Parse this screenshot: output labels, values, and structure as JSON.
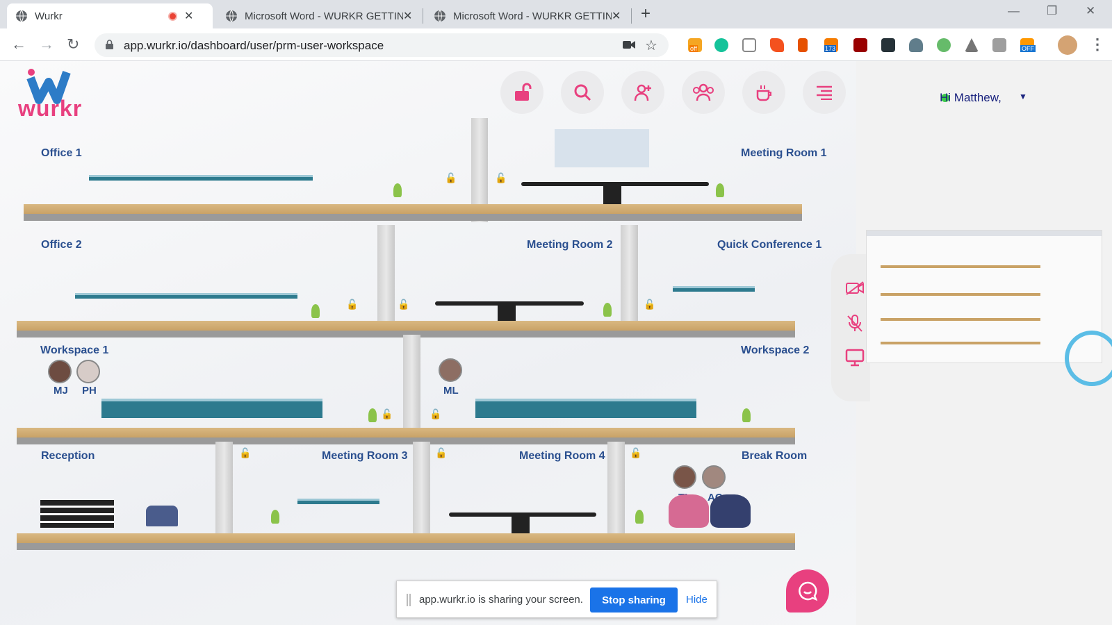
{
  "browser": {
    "tabs": [
      {
        "title": "Wurkr",
        "active": true,
        "recording": true
      },
      {
        "title": "Microsoft Word - WURKR GETTIN",
        "active": false
      },
      {
        "title": "Microsoft Word - WURKR GETTIN",
        "active": false
      }
    ],
    "url": "app.wurkr.io/dashboard/user/prm-user-workspace",
    "extension_badges": {
      "a": "off",
      "b": "173",
      "c": "OFF"
    }
  },
  "app": {
    "logo_text": "wurkr",
    "greeting": "Hi Matthew,",
    "rooms": {
      "office1": "Office 1",
      "meeting1": "Meeting Room 1",
      "office2": "Office 2",
      "meeting2": "Meeting Room 2",
      "quick1": "Quick Conference 1",
      "workspace1": "Workspace 1",
      "workspace2": "Workspace 2",
      "reception": "Reception",
      "meeting3": "Meeting Room 3",
      "meeting4": "Meeting Room 4",
      "breakroom": "Break Room"
    },
    "users": {
      "mj": "MJ",
      "ph": "PH",
      "ml": "ML",
      "tl": "TL",
      "ac": "AC"
    }
  },
  "share_bar": {
    "message": "app.wurkr.io is sharing your screen.",
    "stop_label": "Stop sharing",
    "hide_label": "Hide"
  },
  "colors": {
    "accent": "#e8407f",
    "label": "#2a4f8f",
    "stop": "#1a73e8"
  }
}
